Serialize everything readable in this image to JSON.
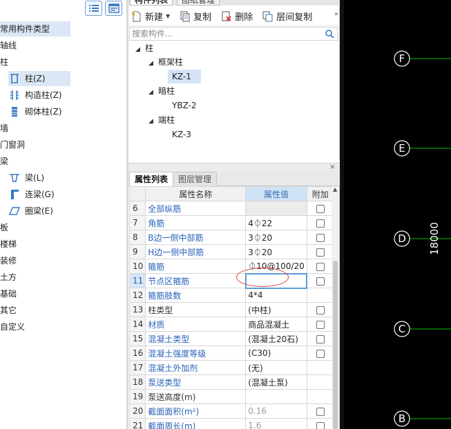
{
  "left_nav": {
    "categories": [
      {
        "label": "常用构件类型"
      },
      {
        "label": "轴线"
      },
      {
        "label": "柱"
      }
    ],
    "column_items": [
      {
        "label": "柱(Z)",
        "icon": "column-icon"
      },
      {
        "label": "构造柱(Z)",
        "icon": "structural-column-icon"
      },
      {
        "label": "砌体柱(Z)",
        "icon": "masonry-column-icon"
      }
    ],
    "more_categories": [
      {
        "label": "墙"
      },
      {
        "label": "门窗洞"
      },
      {
        "label": "梁"
      }
    ],
    "beam_items": [
      {
        "label": "梁(L)",
        "icon": "beam-icon"
      },
      {
        "label": "连梁(G)",
        "icon": "coupling-beam-icon"
      },
      {
        "label": "圈梁(E)",
        "icon": "ring-beam-icon"
      }
    ],
    "tail_categories": [
      {
        "label": "板"
      },
      {
        "label": "楼梯"
      },
      {
        "label": "装修"
      },
      {
        "label": "土方"
      },
      {
        "label": "基础"
      },
      {
        "label": "其它"
      },
      {
        "label": "自定义"
      }
    ]
  },
  "component_panel": {
    "tabs": [
      {
        "label": "构件列表"
      },
      {
        "label": "图纸管理"
      }
    ],
    "toolbar": {
      "new_label": "新建",
      "copy_label": "复制",
      "delete_label": "删除",
      "floor_copy_label": "层间复制",
      "more_label": "»"
    },
    "search": {
      "placeholder": "搜索构件..."
    },
    "tree": {
      "root": "柱",
      "groups": [
        {
          "label": "框架柱",
          "items": [
            "KZ-1"
          ]
        },
        {
          "label": "暗柱",
          "items": [
            "YBZ-2"
          ]
        },
        {
          "label": "端柱",
          "items": [
            "KZ-3"
          ]
        }
      ],
      "selected": "KZ-1"
    }
  },
  "property_panel": {
    "close_label": "×",
    "tabs": [
      {
        "label": "属性列表"
      },
      {
        "label": "图层管理"
      }
    ],
    "headers": {
      "num": "",
      "name": "属性名称",
      "value": "属性值",
      "extra": "附加"
    },
    "rows": [
      {
        "num": "6",
        "name": "全部纵筋",
        "value": "",
        "checkbox": true,
        "blue": true,
        "grey": false
      },
      {
        "num": "7",
        "name": "角筋",
        "value": "4⏀22",
        "checkbox": true,
        "blue": true,
        "grey": false
      },
      {
        "num": "8",
        "name": "B边一侧中部筋",
        "value": "3⏀20",
        "checkbox": true,
        "blue": true,
        "grey": false
      },
      {
        "num": "9",
        "name": "H边一侧中部筋",
        "value": "3⏀20",
        "checkbox": true,
        "blue": true,
        "grey": false
      },
      {
        "num": "10",
        "name": "箍筋",
        "value": "⏀10@100/20",
        "checkbox": true,
        "blue": true,
        "grey": false
      },
      {
        "num": "11",
        "name": "节点区箍筋",
        "value": "",
        "checkbox": true,
        "blue": true,
        "grey": false
      },
      {
        "num": "12",
        "name": "箍筋肢数",
        "value": "4*4",
        "checkbox": false,
        "blue": true,
        "grey": false
      },
      {
        "num": "13",
        "name": "柱类型",
        "value": "(中柱)",
        "checkbox": true,
        "blue": false,
        "grey": false
      },
      {
        "num": "14",
        "name": "材质",
        "value": "商品混凝土",
        "checkbox": true,
        "blue": true,
        "grey": false
      },
      {
        "num": "15",
        "name": "混凝土类型",
        "value": "(混凝土20石)",
        "checkbox": true,
        "blue": true,
        "grey": false
      },
      {
        "num": "16",
        "name": "混凝土强度等级",
        "value": "(C30)",
        "checkbox": true,
        "blue": true,
        "grey": false
      },
      {
        "num": "17",
        "name": "混凝土外加剂",
        "value": "(无)",
        "checkbox": false,
        "blue": true,
        "grey": false
      },
      {
        "num": "18",
        "name": "泵送类型",
        "value": "(混凝土泵)",
        "checkbox": false,
        "blue": true,
        "grey": false
      },
      {
        "num": "19",
        "name": "泵送高度(m)",
        "value": "",
        "checkbox": false,
        "blue": false,
        "grey": false
      },
      {
        "num": "20",
        "name": "截面面积(m²)",
        "value": "0.16",
        "checkbox": true,
        "blue": true,
        "grey": true
      },
      {
        "num": "21",
        "name": "截面周长(m)",
        "value": "1.6",
        "checkbox": true,
        "blue": true,
        "grey": true
      }
    ],
    "current_row": "11"
  },
  "canvas": {
    "background": "#000000",
    "line_color": "#00c000",
    "axis_labels": [
      "F",
      "E",
      "D",
      "C",
      "B"
    ],
    "dimension_text": "18000"
  },
  "colors": {
    "accent": "#2a63b8",
    "selected_bg": "#dce7f5",
    "header_value_bg": "#cfe2f6",
    "annotation_red": "#d33a3a"
  }
}
